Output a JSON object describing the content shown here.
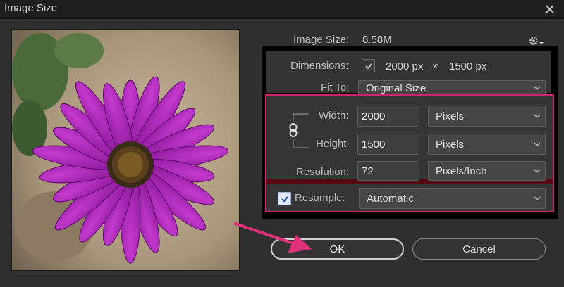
{
  "window": {
    "title": "Image Size"
  },
  "header": {
    "image_size_label": "Image Size:",
    "image_size_value": "8.58M"
  },
  "dimensions": {
    "label": "Dimensions:",
    "width": "2000 px",
    "separator": "×",
    "height": "1500 px"
  },
  "fit_to": {
    "label": "Fit To:",
    "value": "Original Size"
  },
  "width": {
    "label": "Width:",
    "value": "2000",
    "unit": "Pixels"
  },
  "height": {
    "label": "Height:",
    "value": "1500",
    "unit": "Pixels"
  },
  "resolution": {
    "label": "Resolution:",
    "value": "72",
    "unit": "Pixels/Inch"
  },
  "resample": {
    "label": "Resample:",
    "checked": true,
    "value": "Automatic"
  },
  "buttons": {
    "ok": "OK",
    "cancel": "Cancel"
  },
  "colors": {
    "highlight": "#d1246f",
    "panel_border": "#000000",
    "flower": "#a21aa8"
  },
  "icons": [
    "close-icon",
    "gear-icon",
    "chevron-down-icon",
    "chain-link-icon",
    "checkmark-icon",
    "pointer-arrow-icon"
  ]
}
